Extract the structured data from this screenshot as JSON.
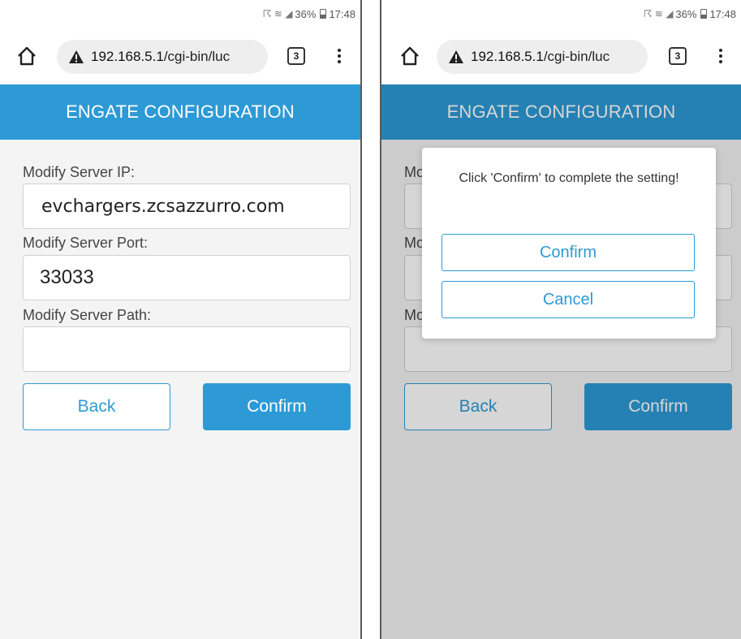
{
  "status_bar": {
    "signal_icons": "☈ ≋ ◢",
    "battery": "36%",
    "time": "17:48"
  },
  "browser": {
    "url_host": "192.168.5.1",
    "url_path": "/cgi-bin/luc",
    "tab_count": "3"
  },
  "header": {
    "title": "ENGATE CONFIGURATION"
  },
  "form": {
    "server_ip_label": "Modify Server IP:",
    "server_ip_value": "evchargers.zcsazzurro.com",
    "server_port_label": "Modify Server Port:",
    "server_port_value": "33033",
    "server_path_label": "Modify Server Path:",
    "server_path_value": "",
    "back_label": "Back",
    "confirm_label": "Confirm"
  },
  "dialog": {
    "message": "Click 'Confirm' to complete the setting!",
    "confirm_label": "Confirm",
    "cancel_label": "Cancel"
  },
  "colors": {
    "accent": "#2d9ad6",
    "background": "#f4f4f4"
  }
}
